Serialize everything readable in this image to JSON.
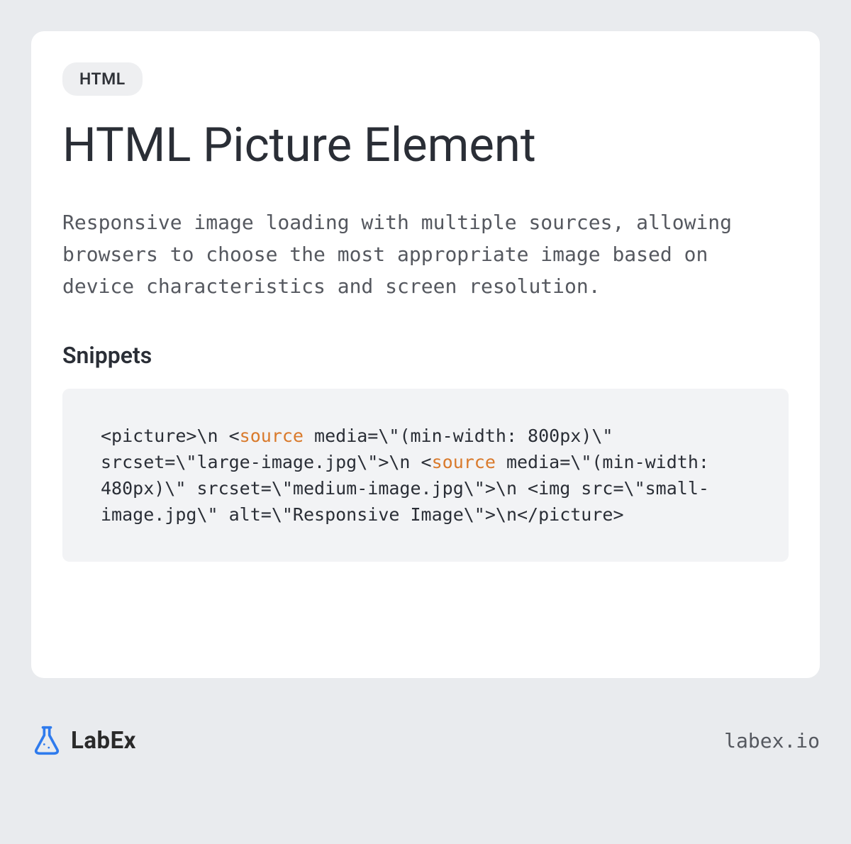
{
  "tag_label": "HTML",
  "title": "HTML Picture Element",
  "description": "Responsive image loading with multiple sources, allowing browsers to choose the most appropriate image based on device characteristics and screen resolution.",
  "section_heading": "Snippets",
  "code": {
    "segments": [
      {
        "text": "<picture>\\n  <",
        "hl": false
      },
      {
        "text": "source",
        "hl": true
      },
      {
        "text": " media=\\\"(min-width: 800px)\\\" srcset=\\\"large-image.jpg\\\">\\n  <",
        "hl": false
      },
      {
        "text": "source",
        "hl": true
      },
      {
        "text": " media=\\\"(min-width: 480px)\\\" srcset=\\\"medium-image.jpg\\\">\\n  <img src=\\\"small-image.jpg\\\" alt=\\\"Responsive Image\\\">\\n</picture>",
        "hl": false
      }
    ]
  },
  "brand_name": "LabEx",
  "site_url": "labex.io",
  "colors": {
    "page_bg": "#e9ebee",
    "card_bg": "#ffffff",
    "tag_bg": "#eeeff1",
    "code_bg": "#f2f3f5",
    "text_primary": "#2a2e36",
    "text_secondary": "#55585f",
    "highlight": "#d97a2c",
    "brand_icon": "#2f7bed"
  }
}
